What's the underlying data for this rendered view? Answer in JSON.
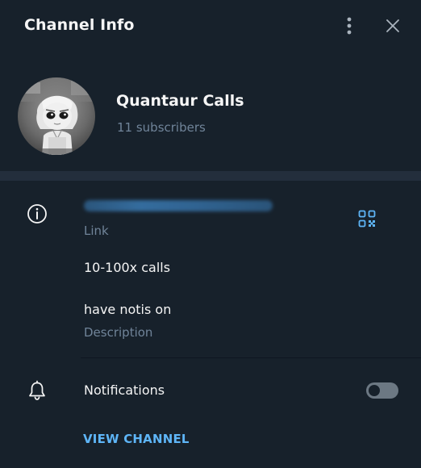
{
  "header": {
    "title": "Channel Info"
  },
  "profile": {
    "name": "Quantaur Calls",
    "subscribers": "11 subscribers"
  },
  "info": {
    "link_label": "Link",
    "calls_text": "10-100x calls",
    "description_value": "have notis on",
    "description_label": "Description"
  },
  "notifications": {
    "label": "Notifications",
    "enabled": false
  },
  "actions": {
    "view_channel": "VIEW CHANNEL"
  },
  "colors": {
    "background": "#17212b",
    "section_divider": "#232e3c",
    "accent": "#5eb5f7",
    "secondary_text": "#708499",
    "icon": "#aab4be"
  },
  "icons": {
    "menu": "kebab-menu-icon",
    "close": "close-icon",
    "info": "info-icon",
    "qr": "qr-code-icon",
    "notifications": "bell-icon"
  }
}
